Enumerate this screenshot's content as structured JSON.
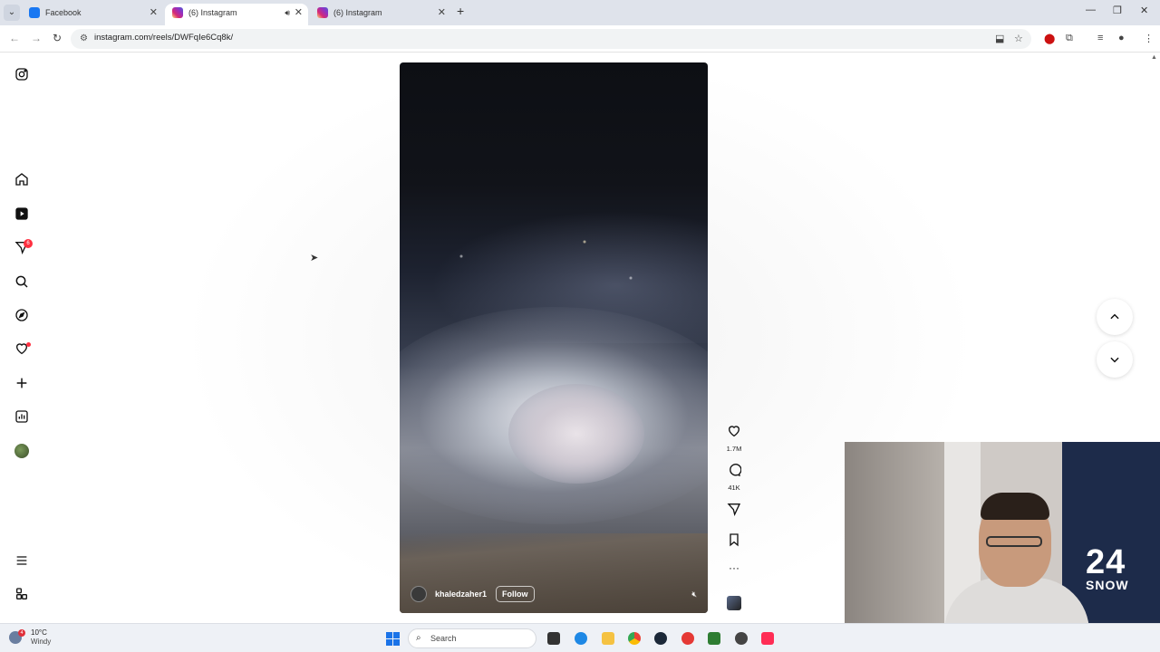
{
  "browser": {
    "tabs": [
      {
        "title": "Facebook",
        "active": false
      },
      {
        "title": "(6) Instagram",
        "active": true
      },
      {
        "title": "(6) Instagram",
        "active": false
      }
    ],
    "url": "instagram.com/reels/DWFqIe6Cq8k/"
  },
  "sidebar": {
    "notifications_badge": "6"
  },
  "reel": {
    "username": "khaledzaher1",
    "follow_label": "Follow",
    "likes": "1.7M",
    "comments": "41K"
  },
  "webcam": {
    "jersey_number": "24",
    "jersey_name": "SNOW"
  },
  "taskbar": {
    "temperature": "10°C",
    "condition": "Windy",
    "weather_badge": "4",
    "search_label": "Search"
  }
}
